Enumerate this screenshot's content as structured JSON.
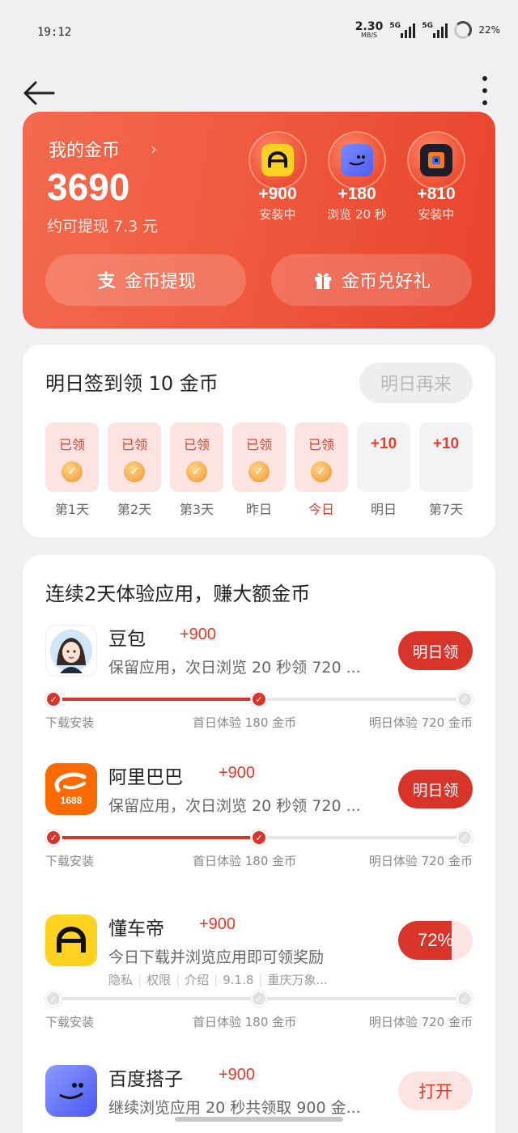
{
  "status_bar": {
    "time": "19:12",
    "net_speed_value": "2.30",
    "net_speed_unit": "MB/S",
    "sim1_label": "5G",
    "sim2_label": "5G",
    "battery": "22%"
  },
  "nav": {
    "back_icon": "arrow-left-icon",
    "more_icon": "more-vertical-icon"
  },
  "coins": {
    "title": "我的金币",
    "amount": "3690",
    "withdrawable": "约可提现 7.3 元",
    "mini_apps": [
      {
        "amount": "+900",
        "status": "安装中",
        "icon": "dongchedi-icon"
      },
      {
        "amount": "+180",
        "status": "浏览 20 秒",
        "icon": "baidu-dazi-icon"
      },
      {
        "amount": "+810",
        "status": "安装中",
        "icon": "cube-app-icon"
      }
    ],
    "withdraw_button": "金币提现",
    "gift_button": "金币兑好礼",
    "colors": {
      "card": "#f05a3e",
      "accent": "#d8342a"
    }
  },
  "signin": {
    "title": "明日签到领 10 金币",
    "button": "明日再来",
    "days": [
      {
        "status": "已领",
        "label": "第1天",
        "claimed": true
      },
      {
        "status": "已领",
        "label": "第2天",
        "claimed": true
      },
      {
        "status": "已领",
        "label": "第3天",
        "claimed": true
      },
      {
        "status": "已领",
        "label": "昨日",
        "claimed": true
      },
      {
        "status": "已领",
        "label": "今日",
        "claimed": true
      },
      {
        "status": "+10",
        "label": "明日",
        "claimed": false
      },
      {
        "status": "+10",
        "label": "第7天",
        "claimed": false
      }
    ]
  },
  "tasks": {
    "title": "连续2天体验应用，赚大额金币",
    "stage_labels": [
      "下载安装",
      "首日体验 180 金币",
      "明日体验 720 金币"
    ],
    "items": [
      {
        "name": "豆包",
        "bonus": "+900",
        "desc": "保留应用，次日浏览 20 秒领 720 ...",
        "button": "明日领",
        "stages_done": 2
      },
      {
        "name": "阿里巴巴",
        "bonus": "+900",
        "desc": "保留应用，次日浏览 20 秒领 720 ...",
        "button": "明日领",
        "stages_done": 2
      },
      {
        "name": "懂车帝",
        "bonus": "+900",
        "desc": "今日下载并浏览应用即可领奖励",
        "meta": [
          "隐私",
          "权限",
          "介绍",
          "9.1.8",
          "重庆万象..."
        ],
        "button": "72%",
        "progress": 0.72,
        "stages_done": 0
      },
      {
        "name": "百度搭子",
        "bonus": "+900",
        "desc": "继续浏览应用 20 秒共领取 900 金...",
        "button": "打开"
      }
    ],
    "alibaba_icon_text": "1688"
  }
}
